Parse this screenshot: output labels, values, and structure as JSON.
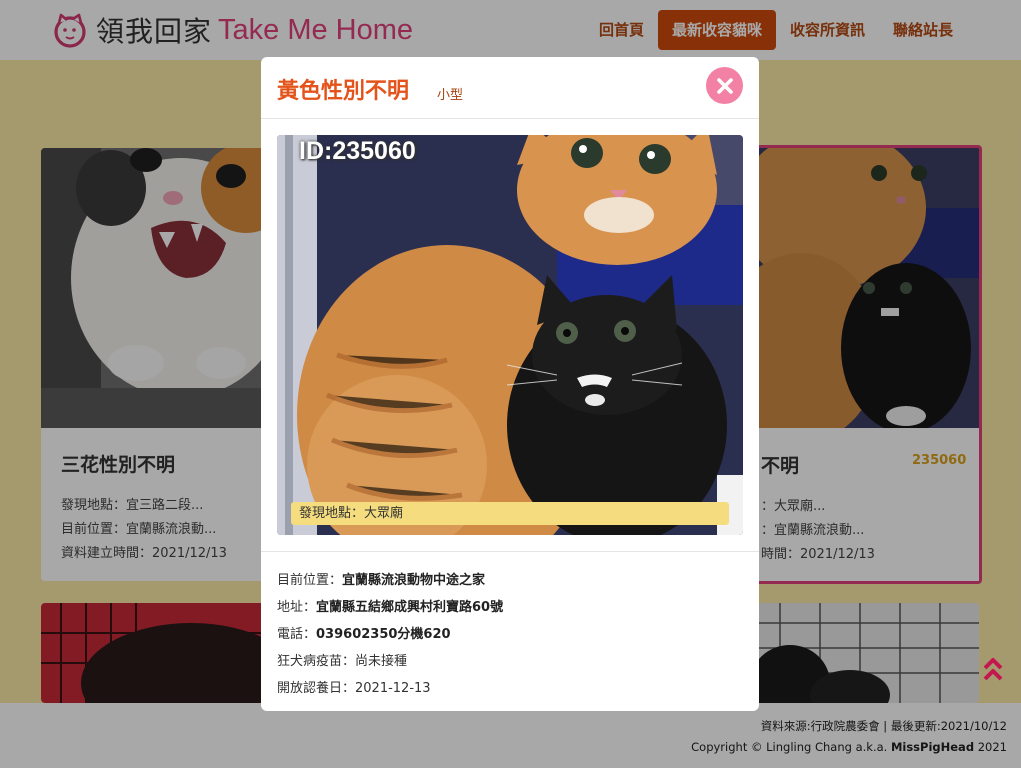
{
  "brand": {
    "name_cn": "領我回家",
    "name_en": "Take Me Home"
  },
  "nav": {
    "items": [
      {
        "label": "回首頁",
        "active": false
      },
      {
        "label": "最新收容貓咪",
        "active": true
      },
      {
        "label": "收容所資訊",
        "active": false
      },
      {
        "label": "聯絡站長",
        "active": false
      }
    ]
  },
  "cards": [
    {
      "title": "三花性別不明",
      "location_label": "發現地點：宜三路二段...",
      "shelter_label": "目前位置：宜蘭縣流浪動...",
      "created_label": "資料建立時間：2021/12/13"
    },
    {
      "title": "不明",
      "id": "235060",
      "location_label": "：大眾廟...",
      "shelter_label": "：宜蘭縣流浪動...",
      "created_label": "時間：2021/12/13"
    }
  ],
  "modal": {
    "title": "黃色性別不明",
    "size": "小型",
    "photo_id": "ID:235060",
    "photo_location": "發現地點：大眾廟",
    "details": {
      "shelter_label": "目前位置：",
      "shelter_value": "宜蘭縣流浪動物中途之家",
      "address_label": "地址：",
      "address_value": "宜蘭縣五結鄉成興村利寶路60號",
      "phone_label": "電話：",
      "phone_value": "039602350分機620",
      "vaccine_label": "狂犬病疫苗：",
      "vaccine_value": "尚未接種",
      "open_date_label": "開放認養日：",
      "open_date_value": "2021-12-13"
    }
  },
  "footer": {
    "source": "資料來源:行政院農委會 | 最後更新:2021/10/12",
    "copyright_prefix": "Copyright © Lingling Chang a.k.a. ",
    "copyright_name": "MissPigHead",
    "copyright_year": " 2021"
  },
  "colors": {
    "accent": "#cf4a0b",
    "brand_pink": "#e2417c",
    "background": "#fbe9a8",
    "close_button": "#f281a5",
    "card_highlight": "#e2417c",
    "id_gold": "#d9a21a"
  },
  "icons": {
    "logo": "cat-logo-icon",
    "close": "close-icon",
    "scroll_top": "chevron-double-up-icon"
  }
}
